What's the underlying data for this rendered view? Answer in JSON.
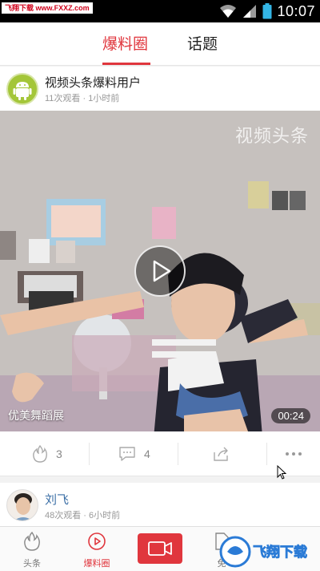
{
  "status": {
    "watermark": "飞翔下载 www.FXXZ.com",
    "time": "10:07"
  },
  "tabs": [
    {
      "label": "爆料圈",
      "active": true
    },
    {
      "label": "话题",
      "active": false
    }
  ],
  "post": {
    "author": "视频头条爆料用户",
    "meta": "11次观看 · 1小时前",
    "video_watermark": "视频头条",
    "caption": "优美舞蹈展",
    "duration": "00:24",
    "likes": "3",
    "comments": "4"
  },
  "post2": {
    "author": "刘飞",
    "meta": "48次观看 · 6小时前"
  },
  "bottom_nav": [
    {
      "label": "头条",
      "icon": "flame-icon"
    },
    {
      "label": "爆料圈",
      "icon": "play-box-icon",
      "active": true
    },
    {
      "label": "",
      "icon": "video-camera-icon"
    },
    {
      "label": "免",
      "icon": "doc-icon"
    }
  ],
  "logo_watermark": "飞翔下载",
  "colors": {
    "accent": "#e0363d",
    "android": "#a4c639"
  }
}
